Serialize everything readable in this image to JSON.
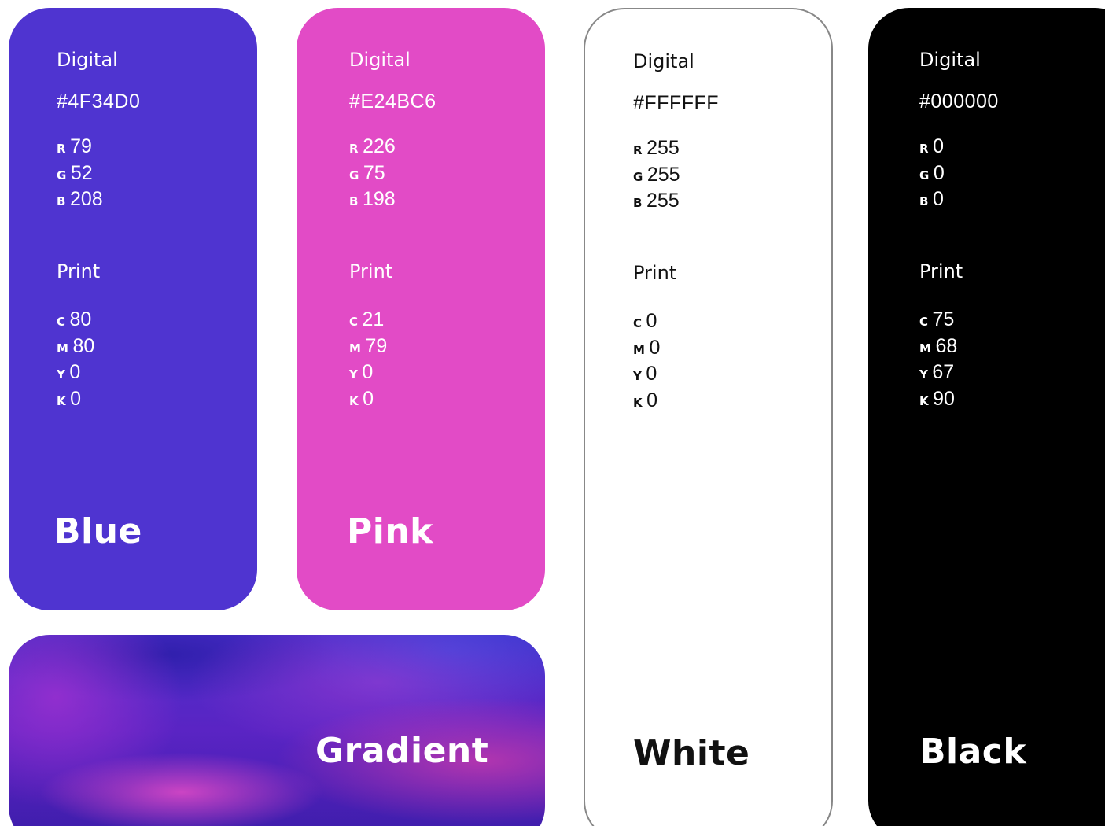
{
  "swatches": [
    {
      "name": "Blue",
      "background": "#4F34D0",
      "text_color": "#FFFFFF",
      "digital_label": "Digital",
      "hex": "#4F34D0",
      "rgb": [
        {
          "letter": "R",
          "value": "79"
        },
        {
          "letter": "G",
          "value": "52"
        },
        {
          "letter": "B",
          "value": "208"
        }
      ],
      "print_label": "Print",
      "cmyk": [
        {
          "letter": "C",
          "value": "80"
        },
        {
          "letter": "M",
          "value": "80"
        },
        {
          "letter": "Y",
          "value": "0"
        },
        {
          "letter": "K",
          "value": "0"
        }
      ]
    },
    {
      "name": "Pink",
      "background": "#E24BC6",
      "text_color": "#FFFFFF",
      "digital_label": "Digital",
      "hex": "#E24BC6",
      "rgb": [
        {
          "letter": "R",
          "value": "226"
        },
        {
          "letter": "G",
          "value": "75"
        },
        {
          "letter": "B",
          "value": "198"
        }
      ],
      "print_label": "Print",
      "cmyk": [
        {
          "letter": "C",
          "value": "21"
        },
        {
          "letter": "M",
          "value": "79"
        },
        {
          "letter": "Y",
          "value": "0"
        },
        {
          "letter": "K",
          "value": "0"
        }
      ]
    },
    {
      "name": "White",
      "background": "#FFFFFF",
      "text_color": "#111111",
      "border_color": "#888888",
      "digital_label": "Digital",
      "hex": "#FFFFFF",
      "rgb": [
        {
          "letter": "R",
          "value": "255"
        },
        {
          "letter": "G",
          "value": "255"
        },
        {
          "letter": "B",
          "value": "255"
        }
      ],
      "print_label": "Print",
      "cmyk": [
        {
          "letter": "C",
          "value": "0"
        },
        {
          "letter": "M",
          "value": "0"
        },
        {
          "letter": "Y",
          "value": "0"
        },
        {
          "letter": "K",
          "value": "0"
        }
      ]
    },
    {
      "name": "Black",
      "background": "#000000",
      "text_color": "#FFFFFF",
      "digital_label": "Digital",
      "hex": "#000000",
      "rgb": [
        {
          "letter": "R",
          "value": "0"
        },
        {
          "letter": "G",
          "value": "0"
        },
        {
          "letter": "B",
          "value": "0"
        }
      ],
      "print_label": "Print",
      "cmyk": [
        {
          "letter": "C",
          "value": "75"
        },
        {
          "letter": "M",
          "value": "68"
        },
        {
          "letter": "Y",
          "value": "67"
        },
        {
          "letter": "K",
          "value": "90"
        }
      ]
    }
  ],
  "gradient": {
    "name": "Gradient",
    "colors": [
      "#4F34D0",
      "#E24BC6"
    ]
  }
}
